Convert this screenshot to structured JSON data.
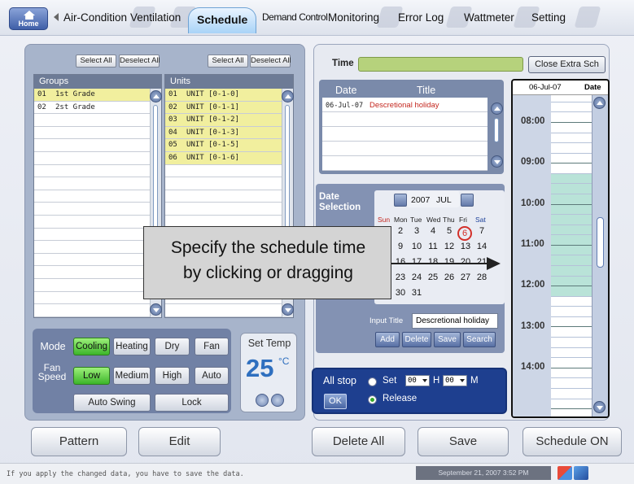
{
  "nav": {
    "home_label": "Home",
    "tabs": [
      {
        "label": "Air-Condition"
      },
      {
        "label": "Ventilation"
      },
      {
        "label": "Schedule"
      },
      {
        "label": "Demand Control"
      },
      {
        "label": "Monitoring"
      },
      {
        "label": "Error Log"
      },
      {
        "label": "Wattmeter"
      },
      {
        "label": "Setting"
      }
    ],
    "active_tab": "Schedule"
  },
  "groups": {
    "select_all": "Select All",
    "deselect_all": "Deselect All",
    "header": "Groups",
    "rows": [
      {
        "num": "01",
        "name": "1st Grade",
        "selected": true
      },
      {
        "num": "02",
        "name": "2st Grade",
        "selected": false
      }
    ]
  },
  "units": {
    "select_all": "Select All",
    "deselect_all": "Deselect All",
    "header": "Units",
    "rows": [
      {
        "num": "01",
        "name": "UNIT [0-1-0]",
        "selected": true
      },
      {
        "num": "02",
        "name": "UNIT [0-1-1]",
        "selected": true
      },
      {
        "num": "03",
        "name": "UNIT [0-1-2]",
        "selected": true
      },
      {
        "num": "04",
        "name": "UNIT [0-1-3]",
        "selected": true
      },
      {
        "num": "05",
        "name": "UNIT [0-1-5]",
        "selected": true
      },
      {
        "num": "06",
        "name": "UNIT [0-1-6]",
        "selected": true
      }
    ]
  },
  "controls": {
    "mode_label": "Mode",
    "modes": [
      "Cooling",
      "Heating",
      "Dry",
      "Fan"
    ],
    "active_mode": "Cooling",
    "fan_label": "Fan Speed",
    "fan_speeds": [
      "Low",
      "Medium",
      "High",
      "Auto"
    ],
    "active_fan": "Low",
    "auto_swing": "Auto Swing",
    "lock": "Lock",
    "set_temp_label": "Set Temp",
    "set_temp_value": "25",
    "temp_unit": "°C"
  },
  "schedule": {
    "time_label": "Time",
    "close_extra": "Close Extra Sch",
    "date_col": "Date",
    "title_col": "Title",
    "entries": [
      {
        "date": "06-Jul-07",
        "title": "Descretional holiday"
      }
    ],
    "date_selection_label": "Date Selection",
    "calendar": {
      "year": "2007",
      "month": "JUL",
      "weekdays": [
        "Sun",
        "Mon",
        "Tue",
        "Wed",
        "Thu",
        "Fri",
        "Sat"
      ],
      "weeks": [
        [
          "1",
          "2",
          "3",
          "4",
          "5",
          "6",
          "7"
        ],
        [
          "8",
          "9",
          "10",
          "11",
          "12",
          "13",
          "14"
        ],
        [
          "15",
          "16",
          "17",
          "18",
          "19",
          "20",
          "21"
        ],
        [
          "22",
          "23",
          "24",
          "25",
          "26",
          "27",
          "28"
        ],
        [
          "29",
          "30",
          "31",
          "",
          "",
          "",
          ""
        ]
      ],
      "selected_day": "6"
    },
    "input_title_label": "Input Title",
    "input_title_value": "Descretional holiday",
    "actions": [
      "Add",
      "Delete",
      "Save",
      "Search"
    ],
    "all_stop_label": "All stop",
    "ok_label": "OK",
    "set_label": "Set",
    "release_label": "Release",
    "hour_value": "00",
    "minute_value": "00",
    "h_label": "H",
    "m_label": "M",
    "release_selected": true
  },
  "time_panel": {
    "date": "06-Jul-07",
    "date_label": "Date",
    "times": [
      "08:00",
      "09:00",
      "10:00",
      "11:00",
      "12:00",
      "13:00",
      "14:00"
    ]
  },
  "callout": {
    "line1": "Specify the schedule time",
    "line2": "by clicking or dragging"
  },
  "bottom": {
    "pattern": "Pattern",
    "edit": "Edit",
    "delete_all": "Delete All",
    "save": "Save",
    "schedule_on": "Schedule ON"
  },
  "status": {
    "message": "If you apply the changed data, you have to save the data.",
    "datetime": "September 21, 2007 3:52 PM"
  }
}
